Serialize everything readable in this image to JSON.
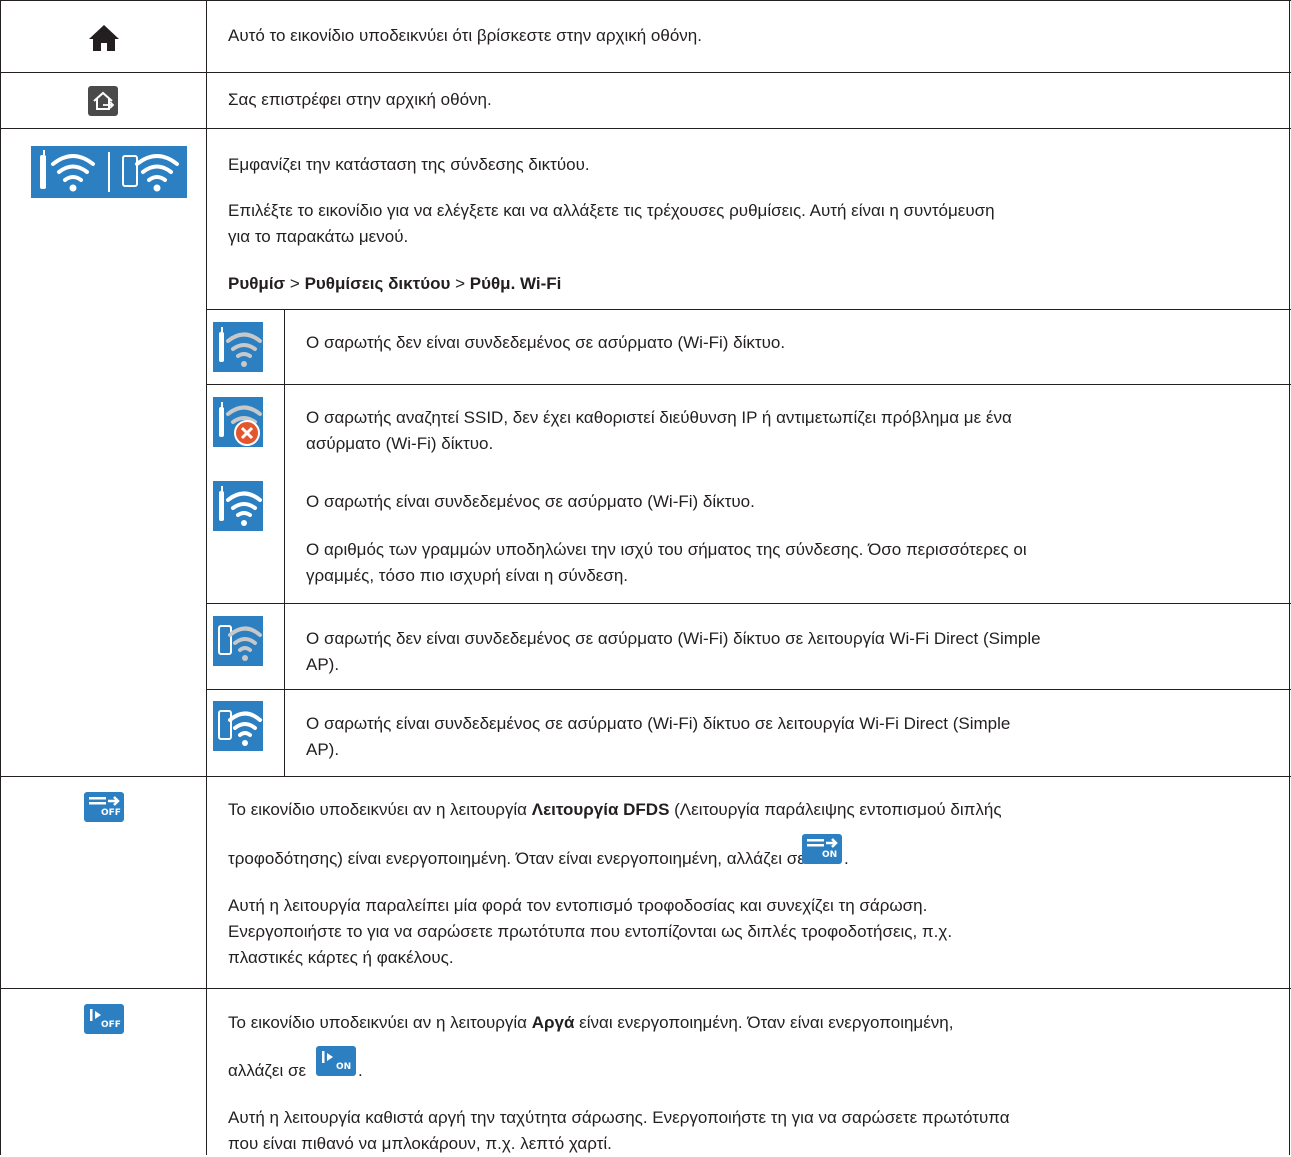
{
  "rows": {
    "home": {
      "icon": "home-icon",
      "text": "Αυτό το εικονίδιο υποδεικνύει ότι βρίσκεστε στην αρχική οθόνη."
    },
    "back_home": {
      "icon": "back-to-home-icon",
      "text": "Σας επιστρέφει στην αρχική οθόνη."
    },
    "network": {
      "icon": "network-status-icon",
      "line1": "Εμφανίζει την κατάσταση της σύνδεσης δικτύου.",
      "line2a": "Επιλέξτε το εικονίδιο για να ελέγξετε και να αλλάξετε τις τρέχουσες ρυθμίσεις. Αυτή είναι η συντόμευση",
      "line2b": "για το παρακάτω μενού.",
      "menu": {
        "p1": "Ρυθμίσ",
        "sep1": " > ",
        "p2": "Ρυθμίσεις δικτύου",
        "sep2": " > ",
        "p3": "Ρύθμ. Wi-Fi"
      },
      "sub": [
        {
          "icon": "wifi-disconnected-icon",
          "l1": "Ο σαρωτής δεν είναι συνδεδεμένος σε ασύρματο (Wi-Fi) δίκτυο."
        },
        {
          "icon": "wifi-error-icon",
          "l1": "Ο σαρωτής αναζητεί SSID, δεν έχει καθοριστεί διεύθυνση IP ή αντιμετωπίζει πρόβλημα με ένα",
          "l2": "ασύρματο (Wi-Fi) δίκτυο."
        },
        {
          "icon": "wifi-connected-icon",
          "l1": "Ο σαρωτής είναι συνδεδεμένος σε ασύρματο (Wi-Fi) δίκτυο.",
          "l2": "Ο αριθμός των γραμμών υποδηλώνει την ισχύ του σήματος της σύνδεσης. Όσο περισσότερες οι",
          "l3": "γραμμές, τόσο πιο ισχυρή είναι η σύνδεση."
        },
        {
          "icon": "wifi-direct-disconnected-icon",
          "l1": "Ο σαρωτής δεν είναι συνδεδεμένος σε ασύρματο (Wi-Fi) δίκτυο σε λειτουργία Wi-Fi Direct (Simple",
          "l2": "AP)."
        },
        {
          "icon": "wifi-direct-connected-icon",
          "l1": "Ο σαρωτής είναι συνδεδεμένος σε ασύρματο (Wi-Fi) δίκτυο σε λειτουργία Wi-Fi Direct (Simple",
          "l2": "AP)."
        }
      ]
    },
    "dfds": {
      "icon": "dfds-off-icon",
      "badge_off": "OFF",
      "badge_on": "ON",
      "l1a": "Το εικονίδιο υποδεικνύει αν η λειτουργία ",
      "l1b": "Λειτουργία DFDS",
      "l1c": " (Λειτουργία παράλειψης εντοπισμού διπλής",
      "l2": "τροφοδότησης) είναι ενεργοποιημένη. Όταν είναι ενεργοποιημένη, αλλάζει σε ",
      "l2end": ".",
      "l3": "Αυτή η λειτουργία παραλείπει μία φορά τον εντοπισμό τροφοδοσίας και συνεχίζει τη σάρωση.",
      "l4": "Ενεργοποιήστε το για να σαρώσετε πρωτότυπα που εντοπίζονται ως διπλές τροφοδοτήσεις, π.χ.",
      "l5": "πλαστικές κάρτες ή φακέλους."
    },
    "slow": {
      "icon": "slow-off-icon",
      "badge_off": "OFF",
      "badge_on": "ON",
      "l1a": "Το εικονίδιο υποδεικνύει αν η λειτουργία ",
      "l1b": "Αργά",
      "l1c": " είναι ενεργοποιημένη. Όταν είναι ενεργοποιημένη,",
      "l2": "αλλάζει σε ",
      "l2end": ".",
      "l3": "Αυτή η λειτουργία καθιστά αργή την ταχύτητα σάρωσης. Ενεργοποιήστε τη για να σαρώσετε πρωτότυπα",
      "l4": "που είναι πιθανό να μπλοκάρουν, π.χ. λεπτό χαρτί."
    }
  },
  "colors": {
    "accent": "#2c7fc1",
    "text": "#231f20",
    "error": "#e4572e"
  }
}
